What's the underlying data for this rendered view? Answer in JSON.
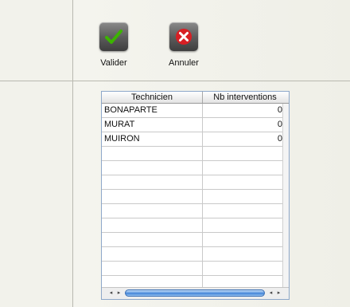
{
  "toolbar": {
    "valider_label": "Valider",
    "annuler_label": "Annuler",
    "valider_color": "#3cb400",
    "annuler_color": "#d81f24"
  },
  "grid": {
    "columns": [
      "Technicien",
      "Nb interventions"
    ],
    "rows": [
      {
        "technicien": "BONAPARTE",
        "nb": "0"
      },
      {
        "technicien": "MURAT",
        "nb": "0"
      },
      {
        "technicien": "MUIRON",
        "nb": "0"
      },
      {
        "technicien": "",
        "nb": ""
      },
      {
        "technicien": "",
        "nb": ""
      },
      {
        "technicien": "",
        "nb": ""
      },
      {
        "technicien": "",
        "nb": ""
      },
      {
        "technicien": "",
        "nb": ""
      },
      {
        "technicien": "",
        "nb": ""
      },
      {
        "technicien": "",
        "nb": ""
      },
      {
        "technicien": "",
        "nb": ""
      },
      {
        "technicien": "",
        "nb": ""
      },
      {
        "technicien": "",
        "nb": ""
      }
    ],
    "scroll_arrows": {
      "left": "◂",
      "right": "▸"
    }
  }
}
